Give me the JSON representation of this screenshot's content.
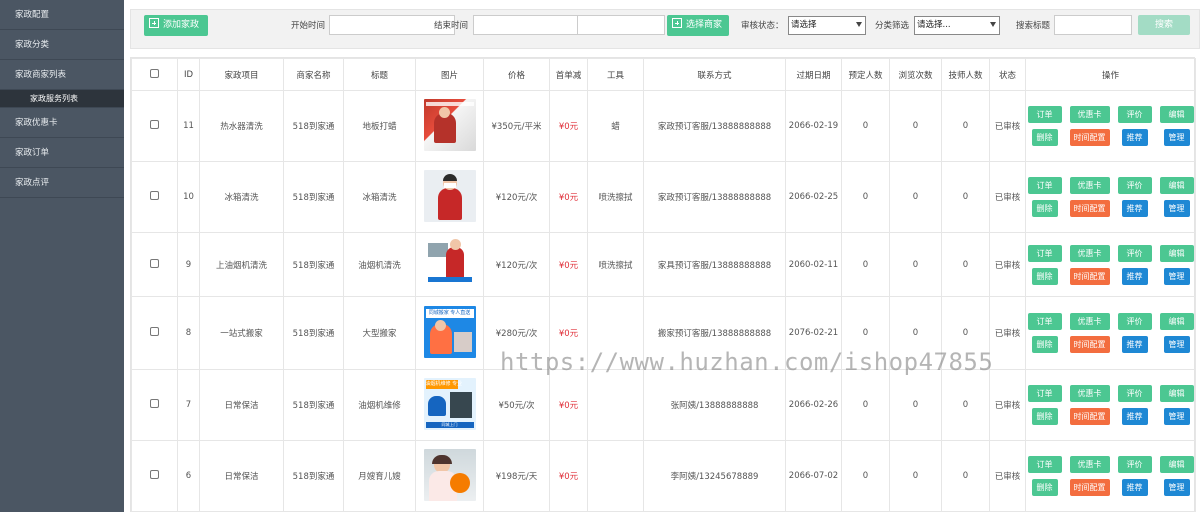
{
  "sidebar": {
    "items": [
      {
        "label": "家政配置"
      },
      {
        "label": "家政分类"
      },
      {
        "label": "家政商家列表"
      },
      {
        "label": "家政服务列表"
      },
      {
        "label": "家政优惠卡"
      },
      {
        "label": "家政订单"
      },
      {
        "label": "家政点评"
      }
    ]
  },
  "toolbar": {
    "add_label": "添加家政",
    "start_label": "开始时间",
    "end_label": "结束时间",
    "select_merchant_label": "选择商家",
    "review_label": "审核状态：",
    "review_select": "请选择",
    "category_label": "分类筛选",
    "category_select": "请选择...",
    "search_title_label": "搜索标题",
    "search_button": "搜索"
  },
  "table": {
    "headers": [
      "",
      "ID",
      "家政项目",
      "商家名称",
      "标题",
      "图片",
      "价格",
      "首单减",
      "工具",
      "联系方式",
      "过期日期",
      "预定人数",
      "浏览次数",
      "技师人数",
      "状态",
      "操作"
    ],
    "rows": [
      {
        "id": "11",
        "project": "热水器清洗",
        "merchant": "518到家通",
        "title": "地板打蜡",
        "price": "¥350元/平米",
        "discount": "¥0元",
        "tool": "蜡",
        "contact": "家政预订客服/13888888888",
        "expire": "2066-02-19",
        "booked": "0",
        "views": "0",
        "techs": "0",
        "status": "已审核"
      },
      {
        "id": "10",
        "project": "冰箱清洗",
        "merchant": "518到家通",
        "title": "冰箱清洗",
        "price": "¥120元/次",
        "discount": "¥0元",
        "tool": "喷洗擦拭",
        "contact": "家政预订客服/13888888888",
        "expire": "2066-02-25",
        "booked": "0",
        "views": "0",
        "techs": "0",
        "status": "已审核"
      },
      {
        "id": "9",
        "project": "上油烟机清洗",
        "merchant": "518到家通",
        "title": "油烟机清洗",
        "price": "¥120元/次",
        "discount": "¥0元",
        "tool": "喷洗擦拭",
        "contact": "家具预订客服/13888888888",
        "expire": "2060-02-11",
        "booked": "0",
        "views": "0",
        "techs": "0",
        "status": "已审核"
      },
      {
        "id": "8",
        "project": "一站式搬家",
        "merchant": "518到家通",
        "title": "大型搬家",
        "price": "¥280元/次",
        "discount": "¥0元",
        "tool": "",
        "contact": "搬家预订客服/13888888888",
        "expire": "2076-02-21",
        "booked": "0",
        "views": "0",
        "techs": "0",
        "status": "已审核"
      },
      {
        "id": "7",
        "project": "日常保洁",
        "merchant": "518到家通",
        "title": "油烟机维修",
        "price": "¥50元/次",
        "discount": "¥0元",
        "tool": "",
        "contact": "张阿姨/13888888888",
        "expire": "2066-02-26",
        "booked": "0",
        "views": "0",
        "techs": "0",
        "status": "已审核"
      },
      {
        "id": "6",
        "project": "日常保洁",
        "merchant": "518到家通",
        "title": "月嫂育儿嫂",
        "price": "¥198元/天",
        "discount": "¥0元",
        "tool": "",
        "contact": "李阿姨/13245678889",
        "expire": "2066-07-02",
        "booked": "0",
        "views": "0",
        "techs": "0",
        "status": "已审核"
      }
    ],
    "ops": {
      "order": "订单",
      "coupon": "优惠卡",
      "rate": "评价",
      "edit": "编辑",
      "delete": "删除",
      "timeconf": "时间配置",
      "recommend": "推荐",
      "manage": "管理"
    }
  },
  "thumb_texts": {
    "row8_banner": "同城搬家 专人直送",
    "row7_banner": "油烟机维修 专业",
    "row7_footer": "同城上门"
  },
  "watermark": "https://www.huzhan.com/ishop47855",
  "colors": {
    "sidebar": "#4b5663",
    "green": "#4cc792",
    "orange": "#f36d3f",
    "blue": "#1e88d4",
    "price_red": "#e0303a"
  }
}
